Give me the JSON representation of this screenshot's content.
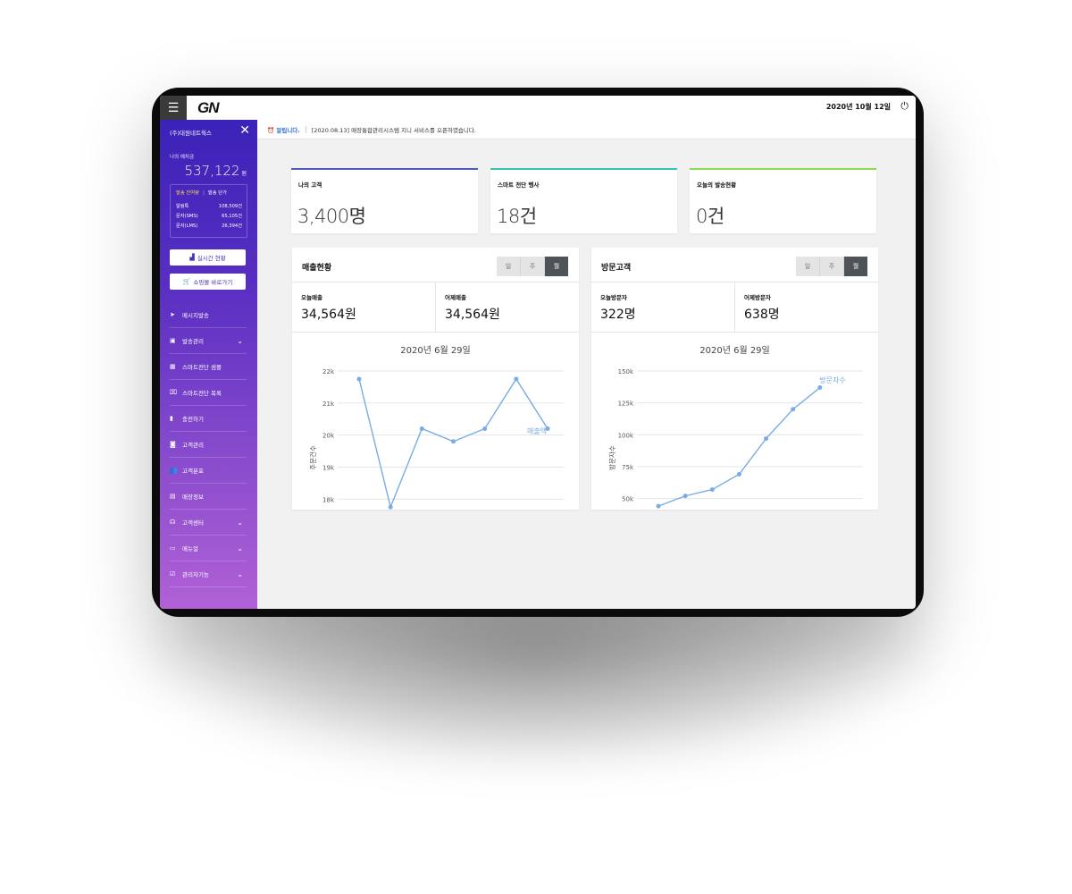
{
  "header": {
    "menu_icon": "menu-icon",
    "logo": "GN",
    "date": "2020년 10월 12일",
    "power_icon": "power-icon"
  },
  "sidebar": {
    "company": "(주)대원네트웍스",
    "deposit_label": "나의 예치금",
    "deposit_value": "537,122",
    "deposit_unit": "원",
    "tabs": [
      "발송 잔여량",
      "발송 단가"
    ],
    "balances": [
      {
        "label": "알림톡",
        "value": "108,509건"
      },
      {
        "label": "문자(SMS)",
        "value": "65,105건"
      },
      {
        "label": "문자(LMS)",
        "value": "26,394건"
      }
    ],
    "realtime_button": "실시간 현황",
    "shop_button": "쇼핑몰 바로가기",
    "nav": [
      {
        "label": "메시지발송",
        "icon": "send-icon",
        "expandable": false
      },
      {
        "label": "발송관리",
        "icon": "id-card-icon",
        "expandable": true
      },
      {
        "label": "스마트전단 샘플",
        "icon": "sample-icon",
        "expandable": false
      },
      {
        "label": "스마트전단 목록",
        "icon": "image-frame-icon",
        "expandable": false
      },
      {
        "label": "충전하기",
        "icon": "battery-icon",
        "expandable": false
      },
      {
        "label": "고객관리",
        "icon": "contact-icon",
        "expandable": false
      },
      {
        "label": "고객분포",
        "icon": "users-icon",
        "expandable": false
      },
      {
        "label": "매장정보",
        "icon": "store-icon",
        "expandable": false
      },
      {
        "label": "고객센터",
        "icon": "headset-icon",
        "expandable": true
      },
      {
        "label": "메뉴얼",
        "icon": "monitor-icon",
        "expandable": true
      },
      {
        "label": "관리자기능",
        "icon": "admin-icon",
        "expandable": true
      }
    ]
  },
  "notice": {
    "tag": "알립니다.",
    "message": "[2020.08.13] 매장통합관리시스템 지니 서비스를 오픈하였습니다."
  },
  "cards": [
    {
      "title": "나의 고객",
      "value": "3,400명",
      "color": "#4e5bb7"
    },
    {
      "title": "스마트 전단 행사",
      "value": "18건",
      "color": "#39c3b2"
    },
    {
      "title": "오늘의 발송현황",
      "value": "0건",
      "color": "#8bdb4f"
    }
  ],
  "panels": [
    {
      "title": "매출현황",
      "segments": [
        "일",
        "주",
        "월"
      ],
      "active_segment": "월",
      "stats": [
        {
          "label": "오늘매출",
          "value": "34,564원"
        },
        {
          "label": "어제매출",
          "value": "34,564원"
        }
      ],
      "chart_title": "2020년 6월 29일"
    },
    {
      "title": "방문고객",
      "segments": [
        "일",
        "주",
        "월"
      ],
      "active_segment": "월",
      "stats": [
        {
          "label": "오늘방문자",
          "value": "322명"
        },
        {
          "label": "어제방문자",
          "value": "638명"
        }
      ],
      "chart_title": "2020년 6월 29일"
    }
  ],
  "chart_data": [
    {
      "type": "line",
      "title": "2020년 6월 29일",
      "ylabel": "주문건수",
      "yticks": [
        "18k",
        "19k",
        "20k",
        "21k",
        "22k"
      ],
      "ylim": [
        17700,
        22000
      ],
      "x": [
        1,
        2,
        3,
        4,
        5,
        6,
        7
      ],
      "series": [
        {
          "name": "매출액",
          "values": [
            21750,
            17750,
            20200,
            19800,
            20200,
            21750,
            20200
          ]
        }
      ],
      "color": "#78ace4",
      "grid": true
    },
    {
      "type": "line",
      "title": "2020년 6월 29일",
      "ylabel": "방문자수",
      "yticks": [
        "50k",
        "75k",
        "100k",
        "125k",
        "150k"
      ],
      "ylim": [
        42000,
        150000
      ],
      "x": [
        1,
        2,
        3,
        4,
        5,
        6,
        7,
        8
      ],
      "series": [
        {
          "name": "방문자수",
          "values": [
            44000,
            52000,
            57000,
            69000,
            97000,
            120000,
            137000
          ]
        }
      ],
      "color": "#78ace4",
      "grid": true
    }
  ]
}
